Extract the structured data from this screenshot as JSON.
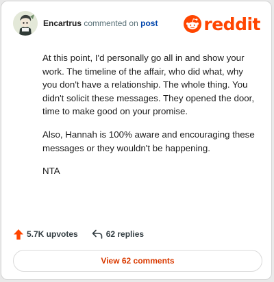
{
  "header": {
    "username": "Encartrus",
    "action_text": "commented on",
    "post_link": "post",
    "brand": "reddit"
  },
  "comment": {
    "paragraphs": [
      "At this point, I'd personally go all in and show your work. The timeline of the affair, who did what, why you don't have a relationship. The whole thing. You didn't solicit these messages. They opened the door, time to make good on your promise.",
      "Also, Hannah is 100% aware and encouraging these messages or they wouldn't be happening.",
      "NTA"
    ]
  },
  "actions": {
    "upvotes": "5.7K upvotes",
    "replies": "62 replies"
  },
  "view_button": "View 62 comments",
  "colors": {
    "brand": "#ff4500",
    "upvote": "#ff4500",
    "link": "#0045ac",
    "view_button_text": "#d93a00"
  },
  "icons": {
    "avatar": "avatar",
    "logo": "reddit-alien-icon",
    "upvote": "upvote-arrow-icon",
    "reply": "reply-arrow-icon"
  }
}
